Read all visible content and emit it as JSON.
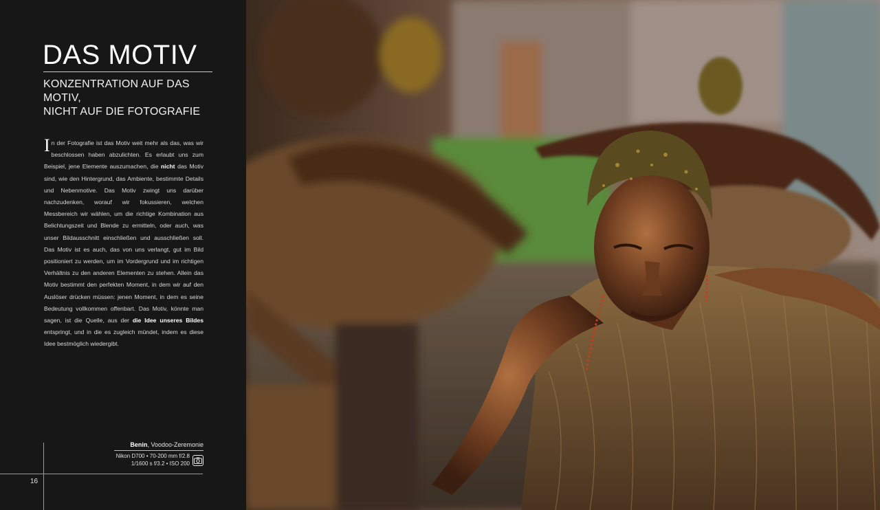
{
  "page": {
    "title": "DAS MOTIV",
    "subtitle_lines": [
      "KONZENTRATION AUF DAS MOTIV,",
      "NICHT AUF DIE FOTOGRAFIE"
    ],
    "page_number": "16"
  },
  "body": {
    "dropcap": "I",
    "part1": "n der Fotografie ist das Motiv weit mehr als das, was wir beschlossen haben abzulichten. Es erlaubt uns zum Beispiel, jene Elemente auszumachen, die ",
    "bold1": "nicht",
    "part2": " das Motiv sind, wie den Hintergrund, das Ambiente, bestimmte Details und Nebenmotive. Das Motiv zwingt uns darüber nachzudenken, worauf wir fokussieren, welchen Messbereich wir wählen, um die richtige Kombination aus Belichtungszeit und Blende zu ermitteln, oder auch, was unser Bildausschnitt einschließen und ausschließen soll. Das Motiv ist es auch, das von uns verlangt, gut im Bild positioniert zu werden, um im Vordergrund und im richtigen Verhältnis zu den anderen Elementen zu stehen. Allein das Motiv bestimmt den perfekten Moment, in dem wir auf den Auslöser drücken müssen: jenen Moment, in dem es seine Bedeutung vollkommen offenbart. Das Motiv, könnte man sagen, ist die Quelle, aus der ",
    "bold2": "die Idee unseres Bildes",
    "part3": " entspringt, und in die es zugleich mündet, indem es diese Idee bestmöglich wiedergibt."
  },
  "caption": {
    "place": "Benin",
    "description": ", Voodoo-Zeremonie",
    "line1": "Nikon D700 • 70-200 mm f/2.8",
    "line2": "1/1600 s  f/3.2 • ISO 200",
    "icon": "camera-icon"
  },
  "colors": {
    "background": "#171717",
    "text": "#e8e8e8"
  }
}
